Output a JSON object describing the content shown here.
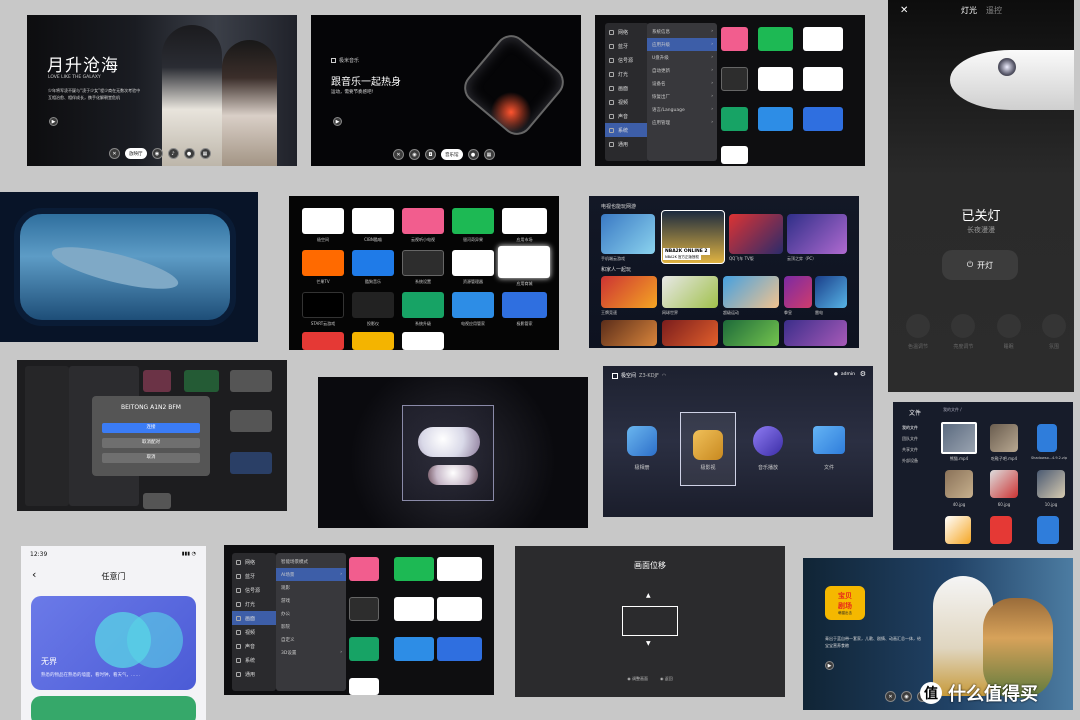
{
  "watermark": {
    "text": "什么值得买"
  },
  "drama": {
    "title": "月升沧海",
    "subtitle": "LOVE LIKE THE GALAXY",
    "desc1": "少年将军凌不疑与“凌于少女”程少商在无数次考验中",
    "desc2": "互相治愈、相伴成长，携手化解朝堂危机",
    "pill": "放映厅"
  },
  "music": {
    "brand": "极米音乐",
    "title": "跟音乐一起热身",
    "desc": "运动，需要节奏感吧!",
    "pill": "音乐馆"
  },
  "settings_menu": {
    "items": [
      "网络",
      "蓝牙",
      "信号源",
      "灯光",
      "画面",
      "视频",
      "声音",
      "系统",
      "通用"
    ],
    "sub": [
      "系统信息",
      "应用升级",
      "U盘升级",
      "自动更新",
      "设备名",
      "恢复出厂",
      "语言/Language",
      "应用管理"
    ]
  },
  "lamp": {
    "tab_light": "灯光",
    "tab_remote": "遥控",
    "status": "已关灯",
    "mode": "长夜漫漫",
    "button": "开灯",
    "controls": [
      "色温调节",
      "亮度调节",
      "睡眠",
      "氛围"
    ]
  },
  "apps": {
    "row1": [
      "极空间",
      "CIBN酷喵",
      "云视听小电视",
      "银河奇异果",
      "应用市场"
    ],
    "row2": [
      "芒果TV",
      "酷狗音乐",
      "系统设置",
      "资源管理器",
      "应用商城"
    ],
    "row3": [
      "START云游戏",
      "投影仪",
      "系统升级",
      "电视应用管家",
      "极影管家"
    ]
  },
  "games": {
    "section1": "电视也能玩网游",
    "section2": "和家人一起玩",
    "featured": "NBA2K ONLINE 2",
    "featured_sub": "NBA2K 官方正版授权",
    "row1": [
      "手机端云游戏",
      "NBA2K ONLINE 2",
      "QQ飞车 TV版",
      "云顶之弈（PC）"
    ],
    "row2": [
      "王牌竞速",
      "网球世界",
      "超级运动",
      "拳皇",
      "雷电"
    ]
  },
  "bt_dialog": {
    "title": "BEITONG A1N2 BFM",
    "connect": "连接",
    "unpair": "取消配对",
    "cancel": "取消"
  },
  "launcher": {
    "brand": "极空间",
    "device": "Z3-KDJF",
    "user": "admin",
    "items": [
      "极相册",
      "极影视",
      "音乐播放",
      "文件"
    ]
  },
  "files": {
    "title": "文件",
    "path": "我的文件 /",
    "nav": [
      "我的文件",
      "团队文件",
      "共享文件",
      "外部设备"
    ],
    "items": [
      "熊猫.mp4",
      "吃鞋子吧.mp4",
      "Shadowso...4.9.2.zip",
      "",
      "40.jpg",
      "60.jpg",
      "10.jpg",
      "",
      "",
      "",
      ""
    ]
  },
  "phone": {
    "time": "12:39",
    "title": "任意门",
    "card_title": "无界",
    "card_desc": "熟悉的物品在熟悉的墙面，看时钟，看天气，……"
  },
  "settings2": {
    "items": [
      "网络",
      "蓝牙",
      "信号源",
      "灯光",
      "画面",
      "视频",
      "声音",
      "系统",
      "通用"
    ],
    "sub": [
      "智能场景模式",
      "AI场景",
      "观影",
      "游戏",
      "办公",
      "影院",
      "自定义",
      "3D设置"
    ]
  },
  "shift": {
    "title": "画面位移",
    "hint1": "调整画面",
    "hint2": "返回"
  },
  "kids": {
    "logo1": "宝贝",
    "logo2": "剧场",
    "logo3": "萌猫出击",
    "desc1": "青出于蓝自带一套家，儿歌、剧情、动画汇总一体，给",
    "desc2": "宝宝营养食粮"
  }
}
